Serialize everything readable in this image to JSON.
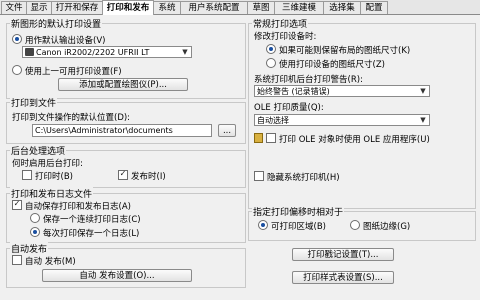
{
  "tabs": [
    "文件",
    "显示",
    "打开和保存",
    "打印和发布",
    "系统",
    "用户系统配置",
    "草图",
    "三维建模",
    "选择集",
    "配置"
  ],
  "active_tab": "打印和发布",
  "new_print_defaults": {
    "title": "新图形的默认打印设置",
    "use_default_device": "用作默认输出设备(V)",
    "device": "Canon iR2002/2202 UFRII LT",
    "use_last": "使用上一可用打印设置(F)",
    "add_plotter_button": "添加或配置绘图仪(P)..."
  },
  "plot_to_file": {
    "title": "打印到文件",
    "label": "打印到文件操作的默认位置(D):",
    "path": "C:\\Users\\Administrator\\documents",
    "browse": "..."
  },
  "background": {
    "title": "后台处理选项",
    "label": "何时启用后台打印:",
    "plotting": "打印时(B)",
    "publishing": "发布时(I)"
  },
  "log": {
    "title": "打印和发布日志文件",
    "auto_save": "自动保存打印和发布日志(A)",
    "one_continuous": "保存一个连续打印日志(C)",
    "one_per_plot": "每次打印保存一个日志(L)"
  },
  "auto_publish": {
    "title": "自动发布",
    "auto": "自动 发布(M)",
    "settings_button": "自动 发布设置(O)..."
  },
  "general": {
    "title": "常规打印选项",
    "modify_label": "修改打印设备时:",
    "keep_layout": "如果可能则保留布局的图纸尺寸(K)",
    "use_device_size": "使用打印设备的图纸尺寸(Z)",
    "spooler_label": "系统打印机后台打印警告(R):",
    "spooler_value": "始终警告 (记录错误)",
    "ole_label": "OLE 打印质量(Q):",
    "ole_value": "自动选择",
    "use_ole_app": "打印 OLE 对象时使用 OLE 应用程序(U)",
    "hide_system": "隐藏系统打印机(H)"
  },
  "offset": {
    "title": "指定打印偏移时相对于",
    "printable": "可打印区域(B)",
    "edge": "图纸边缘(G)"
  },
  "stamp_button": "打印戳记设置(T)...",
  "style_button": "打印样式表设置(S)..."
}
